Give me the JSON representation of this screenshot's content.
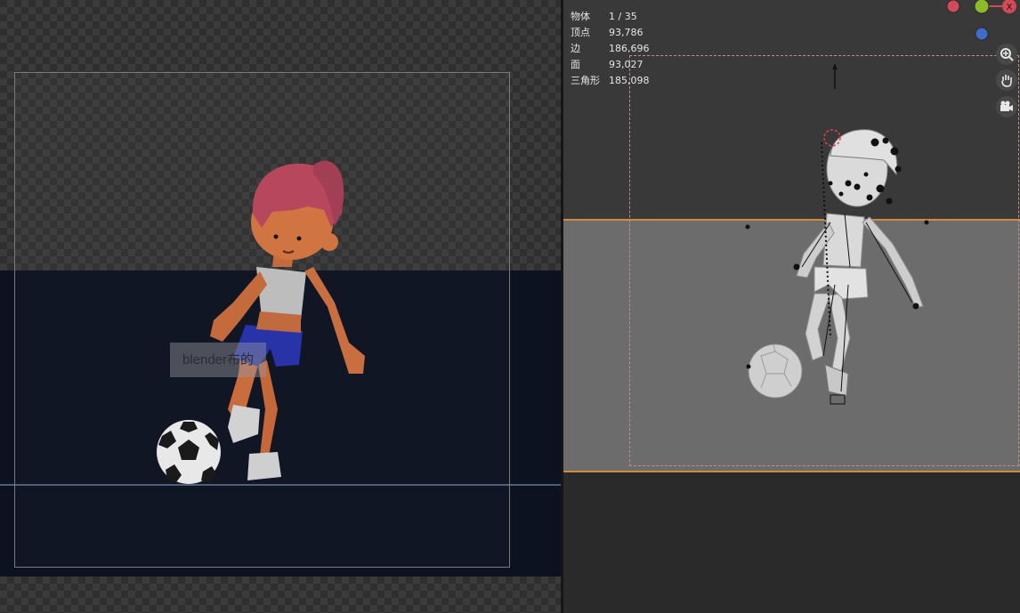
{
  "render": {
    "watermark_text": "blender布的"
  },
  "viewport": {
    "stats": [
      {
        "label": "物体",
        "value": "1 / 35"
      },
      {
        "label": "顶点",
        "value": "93,786"
      },
      {
        "label": "边",
        "value": "186,696"
      },
      {
        "label": "面",
        "value": "93,027"
      },
      {
        "label": "三角形",
        "value": "185,098"
      }
    ],
    "axis_colors": {
      "x": "#d24b5a",
      "y": "#8bbb2a",
      "z": "#3d6cc9"
    },
    "nav_icons": [
      "zoom-icon",
      "hand-pan-icon",
      "camera-view-icon"
    ]
  },
  "colors": {
    "render_lower_bg": "#0d1220",
    "selection_outline": "#d48a3c"
  }
}
